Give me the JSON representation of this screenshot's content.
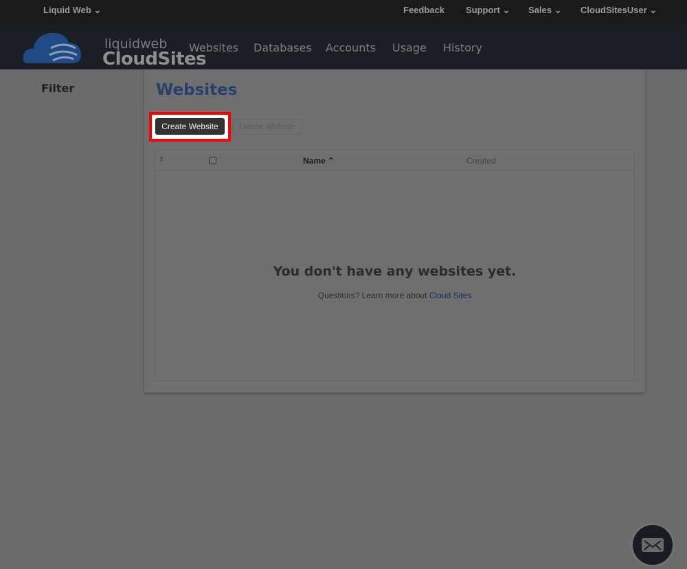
{
  "topbar": {
    "brand": "Liquid Web",
    "feedback": "Feedback",
    "support": "Support",
    "sales": "Sales",
    "user": "CloudSitesUser"
  },
  "logo": {
    "small": "liquidweb",
    "big": "CloudSites"
  },
  "nav": [
    "Websites",
    "Databases",
    "Accounts",
    "Usage",
    "History"
  ],
  "sidebar": {
    "filter": "Filter"
  },
  "main": {
    "title": "Websites",
    "create_label": "Create Website",
    "delete_label": "Delete Website",
    "columns": {
      "name": "Name",
      "created": "Created"
    },
    "empty_title": "You don't have any websites yet.",
    "empty_text": "Questions? Learn more about ",
    "empty_link": "Cloud Sites"
  },
  "colors": {
    "accent": "#27406a",
    "highlight": "#ff0000"
  }
}
